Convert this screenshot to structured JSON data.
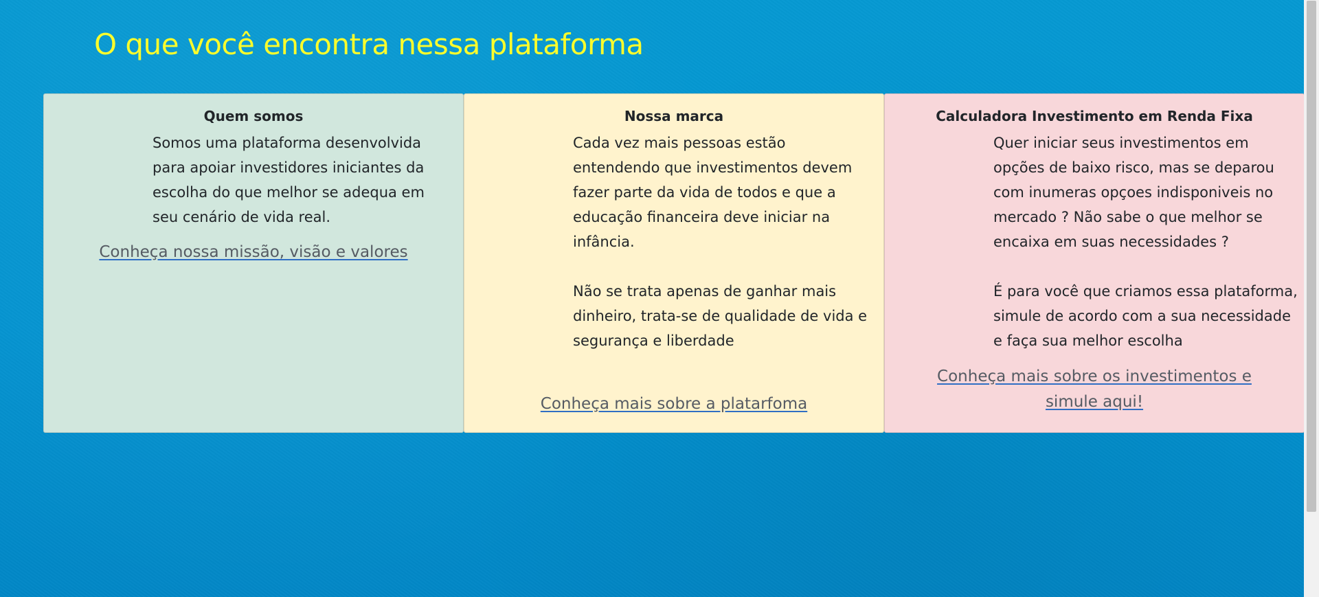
{
  "page": {
    "title": "O que você encontra nessa plataforma"
  },
  "colors": {
    "background": "#0598d2",
    "title": "#fcfc2c",
    "card_green": "#d1e7dd",
    "card_yellow": "#fff3cd",
    "card_pink": "#f8d7da",
    "link": "#555b63",
    "link_underline": "#2f6ec4"
  },
  "cards": [
    {
      "title": "Quem somos",
      "text": "Somos uma plataforma desenvolvida\npara apoiar investidores iniciantes da\nescolha do que melhor se adequa em\nseu cenário de vida real.",
      "link": "Conheça nossa missão, visão e valores"
    },
    {
      "title": "Nossa marca",
      "text": "Cada vez mais pessoas estão\nentendendo que investimentos devem\nfazer parte da vida de todos e que a\neducação financeira deve iniciar na\ninfância.\n\nNão se trata apenas de ganhar mais\ndinheiro, trata-se de qualidade de vida e\nsegurança e liberdade",
      "link": "Conheça mais sobre a platarfoma"
    },
    {
      "title": "Calculadora Investimento em Renda Fixa",
      "text": "Quer iniciar seus investimentos em\nopções de baixo risco, mas se deparou\ncom inumeras opçoes indisponiveis no\nmercado ? Não sabe o que melhor se\nencaixa em suas necessidades ?\n\nÉ para você que criamos essa plataforma,\nsimule de acordo com a sua necessidade\ne faça sua melhor escolha",
      "link": "Conheça mais sobre os investimentos e simule aqui!"
    }
  ]
}
